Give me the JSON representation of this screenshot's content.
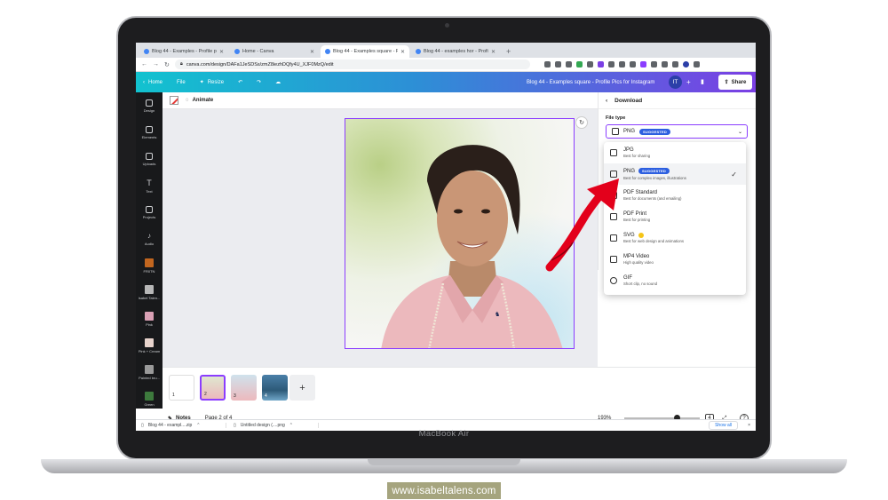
{
  "browser": {
    "tabs": [
      {
        "title": "Blog 44 - Examples - Profile p",
        "active": false
      },
      {
        "title": "Home - Canva",
        "active": false
      },
      {
        "title": "Blog 44 - Examples square - P",
        "active": true
      },
      {
        "title": "Blog 44 - examples hor - Profi",
        "active": false
      }
    ],
    "new_tab": "+",
    "url": "canva.com/design/DAFa1JeSDSs/zmZ8iezhDQfy4U_XJF0MzQ/edit"
  },
  "canva_top": {
    "home": "Home",
    "file": "File",
    "resize": "Resize",
    "doc_title": "Blog 44 - Examples square - Profile Pics for Instagram",
    "avatar": "IT",
    "share": "Share"
  },
  "sidebar": {
    "items": [
      {
        "label": "Design"
      },
      {
        "label": "Elements"
      },
      {
        "label": "Uploads"
      },
      {
        "label": "Text"
      },
      {
        "label": "Projects"
      },
      {
        "label": "Audio"
      },
      {
        "label": "FR0TN"
      },
      {
        "label": "Isabel Talen..."
      },
      {
        "label": "Pink"
      },
      {
        "label": "Pink + Cream"
      },
      {
        "label": "Painted bru..."
      },
      {
        "label": "Green"
      }
    ]
  },
  "editor": {
    "animate": "Animate"
  },
  "pages": {
    "thumbs": [
      "1",
      "2",
      "3",
      "4"
    ],
    "add": "+"
  },
  "bottom_bar": {
    "notes": "Notes",
    "page_indicator": "Page 2 of 4",
    "zoom": "193%",
    "zoom_level": 0.7
  },
  "downloads_shelf": {
    "items": [
      {
        "name": "Blog 44 - exampl....zip"
      },
      {
        "name": "Untitled design (....png"
      }
    ],
    "show_all": "Show all",
    "close": "×"
  },
  "download_panel": {
    "title": "Download",
    "file_type_label": "File type",
    "selected_type": "PNG",
    "selected_badge": "SUGGESTED",
    "options": [
      {
        "title": "JPG",
        "desc": "Best for sharing"
      },
      {
        "title": "PNG",
        "badge": "SUGGESTED",
        "desc": "Best for complex images, illustrations",
        "selected": true
      },
      {
        "title": "PDF Standard",
        "desc": "Best for documents (and emailing)"
      },
      {
        "title": "PDF Print",
        "desc": "Best for printing"
      },
      {
        "title": "SVG",
        "desc": "Best for web design and animations"
      },
      {
        "title": "MP4 Video",
        "desc": "High quality video"
      },
      {
        "title": "GIF",
        "desc": "Short clip, no sound"
      }
    ]
  },
  "laptop": {
    "brand": "MacBook Air"
  },
  "site_badge": "www.isabeltalens.com",
  "colors": {
    "canva_gradient_start": "#12c2cf",
    "canva_gradient_end": "#7b3fe4",
    "selection_purple": "#8b3dff",
    "badge_blue": "#2d5fe0",
    "arrow_red": "#e3001b",
    "site_badge_bg": "#a5a47e"
  }
}
